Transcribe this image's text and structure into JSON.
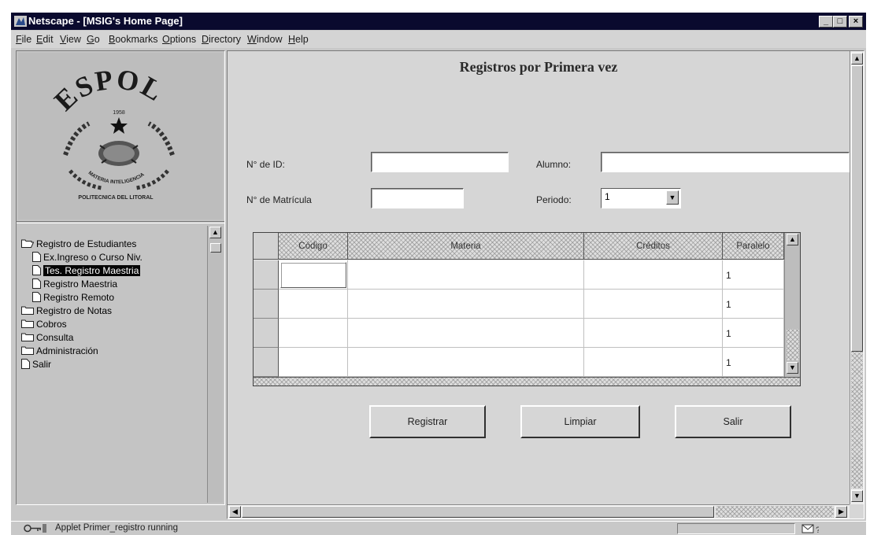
{
  "window": {
    "title": "Netscape - [MSIG's Home Page]"
  },
  "menu": [
    {
      "accel": "F",
      "rest": "ile"
    },
    {
      "accel": "E",
      "rest": "dit"
    },
    {
      "accel": "V",
      "rest": "iew"
    },
    {
      "accel": "G",
      "rest": "o"
    },
    {
      "accel": "B",
      "rest": "ookmarks"
    },
    {
      "accel": "O",
      "rest": "ptions"
    },
    {
      "accel": "D",
      "rest": "irectory"
    },
    {
      "accel": "W",
      "rest": "indow"
    },
    {
      "accel": "H",
      "rest": "elp"
    }
  ],
  "logo": {
    "name": "ESPOL",
    "year": "1958",
    "motto": "MATERIA INTELIGENCIA",
    "institution": "POLITECNICA DEL LITORAL"
  },
  "tree": [
    {
      "label": "Registro de Estudiantes",
      "type": "folder-open"
    },
    {
      "label": "Ex.Ingreso o Curso Niv.",
      "type": "doc"
    },
    {
      "label": "Tes. Registro Maestria",
      "type": "doc",
      "selected": true
    },
    {
      "label": "Registro Maestria",
      "type": "doc"
    },
    {
      "label": "Registro Remoto",
      "type": "doc"
    },
    {
      "label": "Registro de Notas",
      "type": "folder"
    },
    {
      "label": "Cobros",
      "type": "folder"
    },
    {
      "label": "Consulta",
      "type": "folder"
    },
    {
      "label": "Administración",
      "type": "folder"
    },
    {
      "label": "Salir",
      "type": "doc"
    }
  ],
  "form": {
    "title": "Registros por Primera vez",
    "id_label": "N° de ID:",
    "id_value": "",
    "matricula_label": "N° de Matrícula",
    "matricula_value": "",
    "alumno_label": "Alumno:",
    "alumno_value": "",
    "periodo_label": "Periodo:",
    "periodo_value": "1"
  },
  "table": {
    "columns": [
      "Código",
      "Materia",
      "Créditos",
      "Paralelo"
    ],
    "rows": [
      {
        "codigo": "",
        "materia": "",
        "creditos": "",
        "paralelo": "1"
      },
      {
        "codigo": "",
        "materia": "",
        "creditos": "",
        "paralelo": "1"
      },
      {
        "codigo": "",
        "materia": "",
        "creditos": "",
        "paralelo": "1"
      },
      {
        "codigo": "",
        "materia": "",
        "creditos": "",
        "paralelo": "1"
      }
    ]
  },
  "buttons": {
    "register": "Registrar",
    "clear": "Limpiar",
    "exit": "Salir"
  },
  "status": {
    "text": "Applet Primer_registro running"
  }
}
